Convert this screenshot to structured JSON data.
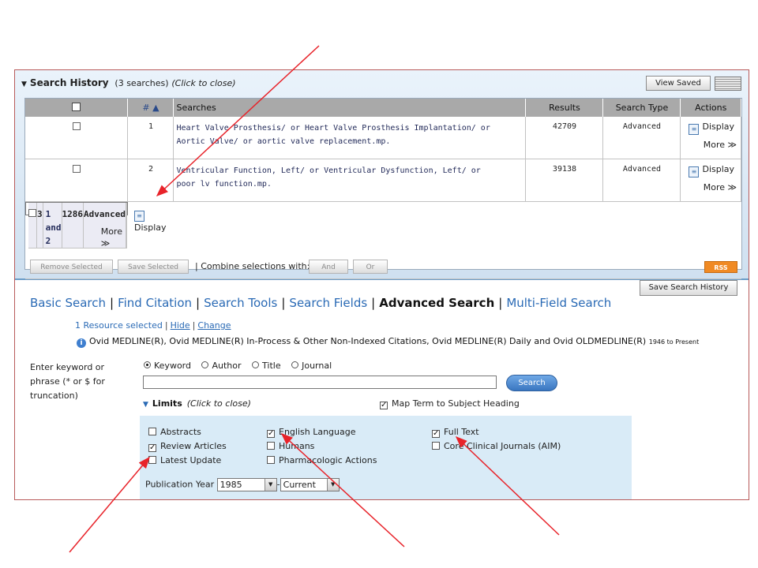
{
  "history": {
    "title": "Search History",
    "count_text": "(3 searches)",
    "close_hint": "(Click to close)",
    "view_saved_label": "View Saved",
    "columns": {
      "num": "# ▲",
      "searches": "Searches",
      "results": "Results",
      "search_type": "Search Type",
      "actions": "Actions"
    },
    "rows": [
      {
        "num": "1",
        "query_line1": "Heart Valve Prosthesis/ or Heart Valve Prosthesis Implantation/ or",
        "query_line2": "Aortic Valve/ or aortic valve replacement.mp.",
        "results": "42709",
        "type": "Advanced",
        "display": "Display",
        "more": "More ≫"
      },
      {
        "num": "2",
        "query_line1": "Ventricular Function, Left/ or Ventricular Dysfunction, Left/ or",
        "query_line2": "poor lv function.mp.",
        "results": "39138",
        "type": "Advanced",
        "display": "Display",
        "more": "More ≫"
      },
      {
        "num": "3",
        "query_line1": "1 and 2",
        "query_line2": "",
        "results": "1286",
        "type": "Advanced",
        "display": "Display",
        "more": "More ≫"
      }
    ],
    "remove_selected_label": "Remove Selected",
    "save_selected_label": "Save Selected",
    "combine_label": "| Combine selections with:",
    "and_label": "And",
    "or_label": "Or",
    "rss_label": "RSS",
    "save_history_label": "Save Search History"
  },
  "tabs": {
    "basic": "Basic Search",
    "find_citation": "Find Citation",
    "search_tools": "Search Tools",
    "search_fields": "Search Fields",
    "advanced": "Advanced Search",
    "multi_field": "Multi-Field Search",
    "separator": "|"
  },
  "resources": {
    "selected_text": "1 Resource selected",
    "bar": "|",
    "hide": "Hide",
    "change": "Change",
    "db_line": "Ovid MEDLINE(R), Ovid MEDLINE(R) In-Process & Other Non-Indexed Citations, Ovid MEDLINE(R) Daily and Ovid OLDMEDLINE(R)",
    "db_range": "1946 to Present"
  },
  "search": {
    "keyword_label": "Enter keyword or phrase (* or $ for truncation)",
    "mode_keyword": "Keyword",
    "mode_author": "Author",
    "mode_title": "Title",
    "mode_journal": "Journal",
    "input_value": "",
    "search_button": "Search"
  },
  "limits": {
    "title": "Limits",
    "close_hint": "(Click to close)",
    "map_term": "Map Term to Subject Heading",
    "abstracts": "Abstracts",
    "review_articles": "Review Articles",
    "latest_update": "Latest Update",
    "english_language": "English Language",
    "humans": "Humans",
    "pharmacologic_actions": "Pharmacologic Actions",
    "full_text": "Full Text",
    "core_clinical": "Core Clinical Journals (AIM)",
    "pub_year_label": "Publication Year",
    "year_from": "1985",
    "year_dash": "-",
    "year_to": "Current"
  }
}
